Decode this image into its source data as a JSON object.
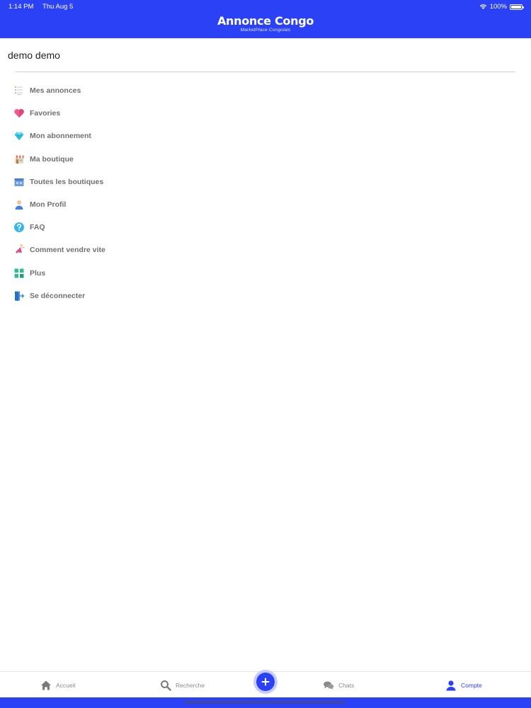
{
  "status": {
    "time": "1:14 PM",
    "date": "Thu Aug 5",
    "battery": "100%"
  },
  "brand": {
    "title": "Annonce Congo",
    "subtitle": "MarketPlace Congolais"
  },
  "user": {
    "name": "demo demo"
  },
  "menu": {
    "items": [
      {
        "label": "Mes annonces",
        "icon": "list-icon"
      },
      {
        "label": "Favories",
        "icon": "heart-icon"
      },
      {
        "label": "Mon abonnement",
        "icon": "diamond-icon"
      },
      {
        "label": "Ma boutique",
        "icon": "shop-icon"
      },
      {
        "label": "Toutes les boutiques",
        "icon": "shops-icon"
      },
      {
        "label": "Mon Profil",
        "icon": "profile-icon"
      },
      {
        "label": "FAQ",
        "icon": "question-icon"
      },
      {
        "label": "Comment vendre vite",
        "icon": "megaphone-icon"
      },
      {
        "label": "Plus",
        "icon": "grid-icon"
      },
      {
        "label": "Se déconnecter",
        "icon": "logout-icon"
      }
    ]
  },
  "tabs": {
    "home": "Accueil",
    "search": "Recherche",
    "chats": "Chats",
    "account": "Compte"
  },
  "colors": {
    "primary": "#2b41f5",
    "text_muted": "#707070"
  }
}
